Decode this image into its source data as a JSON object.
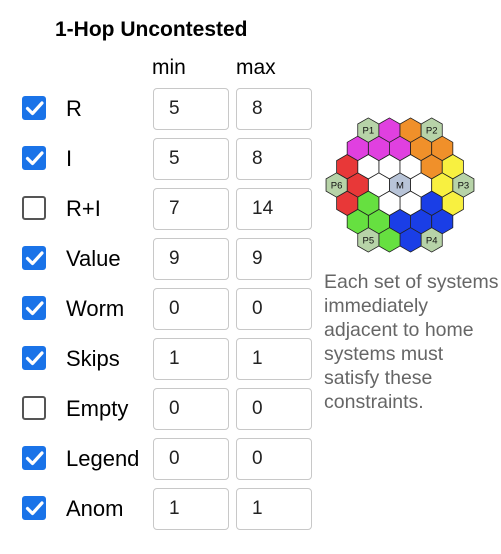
{
  "title": "1-Hop Uncontested",
  "columns": {
    "min": "min",
    "max": "max"
  },
  "rows": [
    {
      "label": "R",
      "checked": true,
      "min": "5",
      "max": "8"
    },
    {
      "label": "I",
      "checked": true,
      "min": "5",
      "max": "8"
    },
    {
      "label": "R+I",
      "checked": false,
      "min": "7",
      "max": "14"
    },
    {
      "label": "Value",
      "checked": true,
      "min": "9",
      "max": "9"
    },
    {
      "label": "Worm",
      "checked": true,
      "min": "0",
      "max": "0"
    },
    {
      "label": "Skips",
      "checked": true,
      "min": "1",
      "max": "1"
    },
    {
      "label": "Empty",
      "checked": false,
      "min": "0",
      "max": "0"
    },
    {
      "label": "Legend",
      "checked": true,
      "min": "0",
      "max": "0"
    },
    {
      "label": "Anom",
      "checked": true,
      "min": "1",
      "max": "1"
    }
  ],
  "map": {
    "center_label": "M",
    "home_labels": [
      "P1",
      "P2",
      "P3",
      "P4",
      "P5",
      "P6"
    ],
    "colors": {
      "P1": "#e040e0",
      "P2": "#f0902a",
      "P3": "#f8f040",
      "P4": "#1a3ee6",
      "P5": "#66e040",
      "P6": "#e83838",
      "home": "#b7d3a8",
      "center": "#b8c4d8",
      "empty": "#ffffff",
      "stroke": "#222222"
    }
  },
  "description": "Each set of systems immediately adjacent to home systems must satisfy these constraints.",
  "checkbox_color": "#1a73e8"
}
